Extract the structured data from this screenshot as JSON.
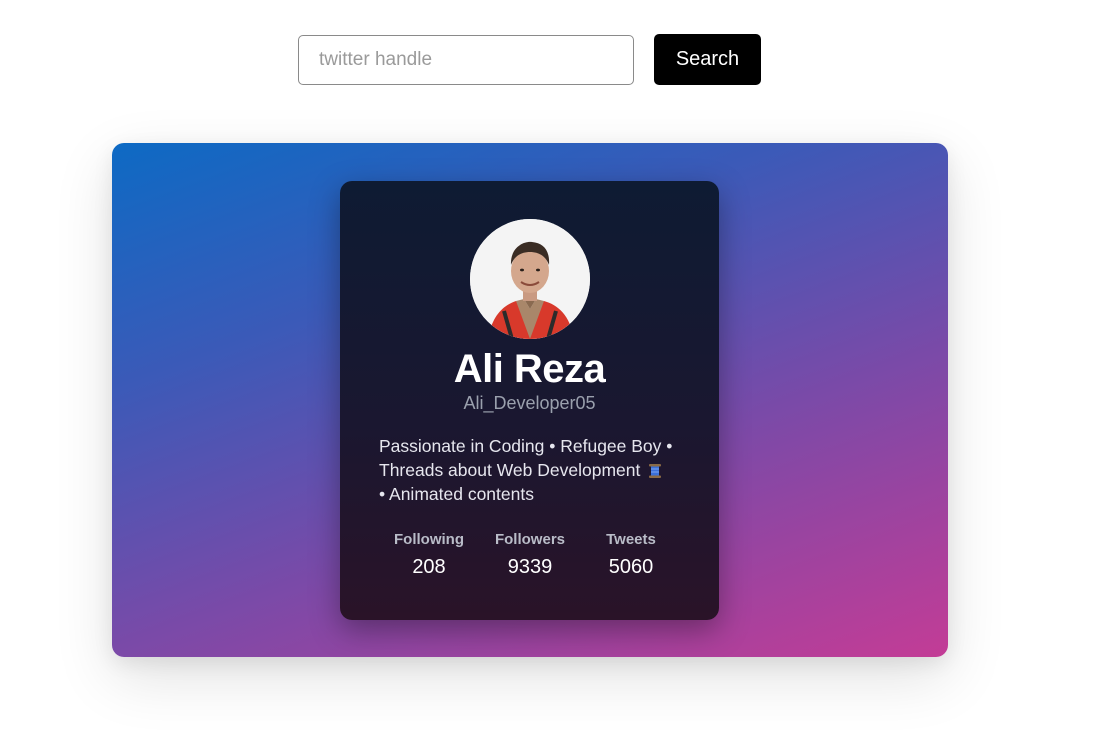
{
  "search": {
    "placeholder": "twitter handle",
    "value": "",
    "button_label": "Search"
  },
  "profile": {
    "avatar_icon": "profile-photo",
    "name": "Ali Reza",
    "handle": "Ali_Developer05",
    "bio_line1": "Passionate in Coding • Refugee Boy •",
    "bio_line2": "Threads about Web Development",
    "bio_line3": "• Animated contents",
    "bio_emoji_icon": "thread-spool-icon",
    "stats": [
      {
        "label": "Following",
        "value": "208"
      },
      {
        "label": "Followers",
        "value": "9339"
      },
      {
        "label": "Tweets",
        "value": "5060"
      }
    ]
  },
  "colors": {
    "gradient_start": "#0d6ac4",
    "gradient_end": "#c33c96",
    "card_bg": "#141a30",
    "button_bg": "#000000"
  }
}
